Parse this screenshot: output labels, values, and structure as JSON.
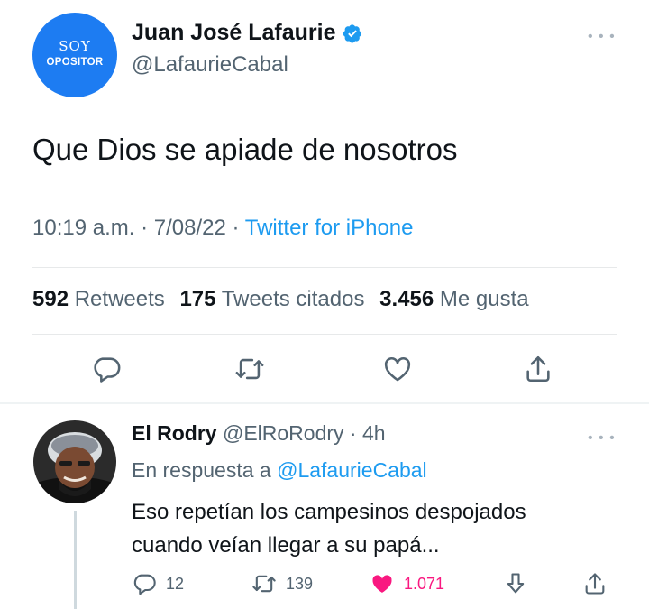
{
  "tweet": {
    "avatar": {
      "line1": "SOY",
      "line2": "OPOSITOR",
      "color": "#1d7cf2"
    },
    "name": "Juan José Lafaurie",
    "handle": "@LafaurieCabal",
    "verified_icon": "verified-badge-icon",
    "more_icon": "more-icon",
    "text": "Que Dios se apiade de nosotros",
    "time": "10:19 a.m.",
    "date": "7/08/22",
    "separator": "·",
    "source": "Twitter for iPhone",
    "stats": {
      "retweets_count": "592",
      "retweets_label": "Retweets",
      "quotes_count": "175",
      "quotes_label": "Tweets citados",
      "likes_count": "3.456",
      "likes_label": "Me gusta"
    },
    "actions": [
      "reply-icon",
      "retweet-icon",
      "like-icon",
      "share-icon"
    ]
  },
  "reply": {
    "name": "El Rodry",
    "handle": "@ElRoRodry",
    "age": "· 4h",
    "replying_prefix": "En respuesta a",
    "replying_to": "@LafaurieCabal",
    "text_line1": "Eso repetían los campesinos despojados",
    "text_line2": "cuando veían llegar a su papá...",
    "counts": {
      "replies": "12",
      "retweets": "139",
      "likes": "1.071"
    },
    "liked_color": "#f91880"
  },
  "colors": {
    "accent": "#1d9bf0",
    "muted": "#536471",
    "text": "#0f1419"
  }
}
